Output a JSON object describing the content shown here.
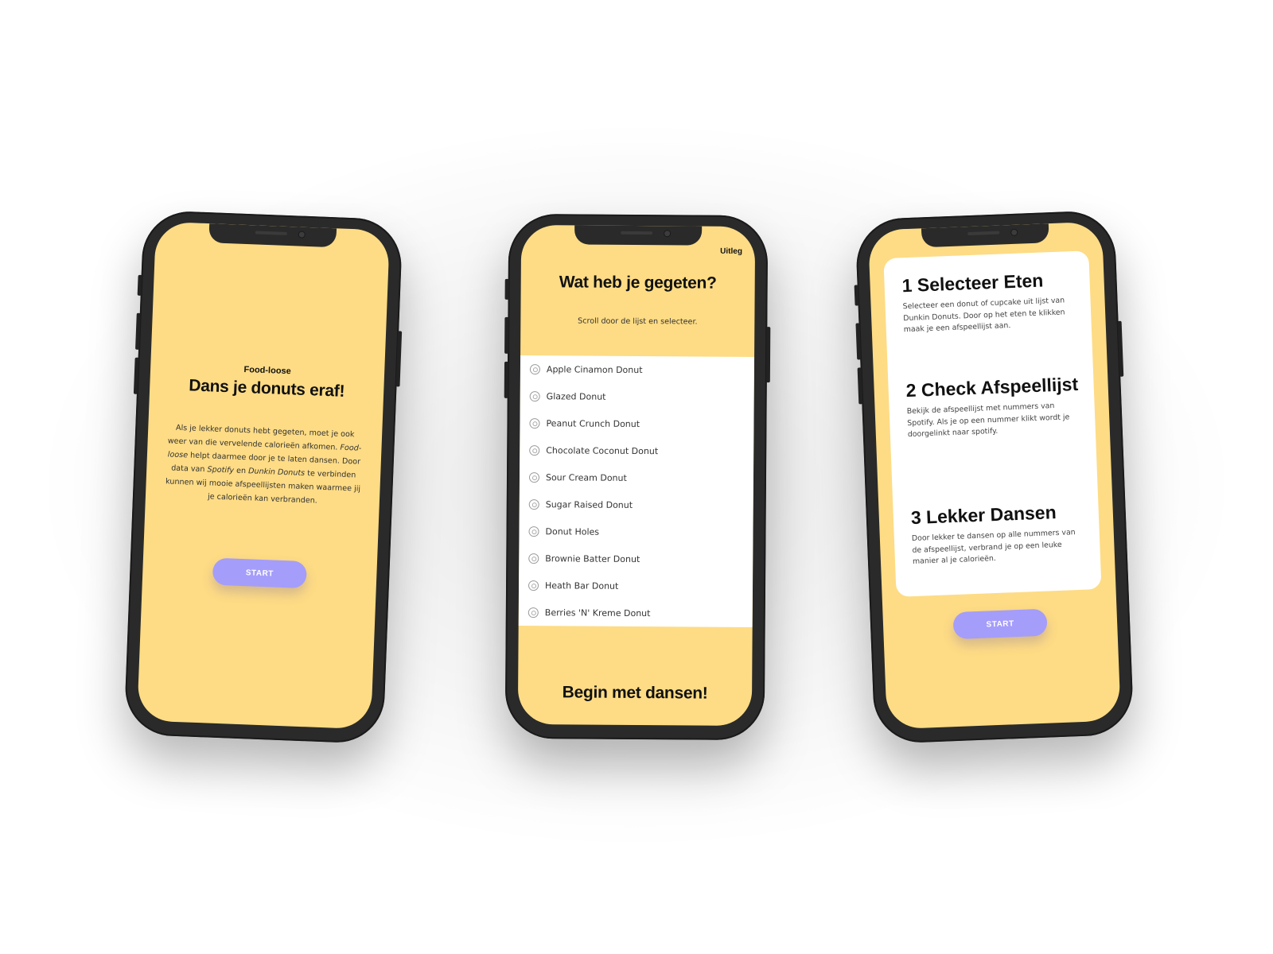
{
  "screen1": {
    "brand": "Food-loose",
    "title": "Dans je donuts eraf!",
    "body": {
      "p1": "Als je lekker donuts hebt gegeten, moet je ook weer van die vervelende calorieën afkomen. ",
      "brand_em": "Food-loose",
      "p2": " helpt daarmee door je te laten dansen. Door data van ",
      "spotify_em": "Spotify",
      "p3": " en ",
      "dunkin_em": "Dunkin Donuts",
      "p4": " te verbinden kunnen wij mooie afspeellijsten maken waarmee jij je calorieën kan verbranden."
    },
    "start_label": "START"
  },
  "screen2": {
    "explain_link": "Uitleg",
    "title": "Wat heb je gegeten?",
    "subtitle": "Scroll door de lijst en selecteer.",
    "items": [
      "Apple Cinamon Donut",
      "Glazed Donut",
      "Peanut Crunch Donut",
      "Chocolate Coconut Donut",
      "Sour Cream Donut",
      "Sugar Raised Donut",
      "Donut Holes",
      "Brownie Batter Donut",
      "Heath Bar Donut",
      "Berries 'N' Kreme Donut"
    ],
    "item_icon": "donut-icon",
    "bottom_title": "Begin met dansen!"
  },
  "screen3": {
    "steps": [
      {
        "title": "1 Selecteer Eten",
        "text": "Selecteer een donut of cupcake uit lijst van Dunkin Donuts. Door op het eten te klikken maak je een afspeellijst aan."
      },
      {
        "title": "2 Check Afspeellijst",
        "text": "Bekijk de afspeellijst met nummers van Spotify. Als je op een nummer klikt wordt je doorgelinkt naar spotify."
      },
      {
        "title": "3 Lekker Dansen",
        "text": "Door lekker te dansen op alle nummers van de afspeellijst, verbrand je op een leuke manier al je calorieën."
      }
    ],
    "start_label": "START"
  },
  "colors": {
    "screen_bg": "#fedc85",
    "button": "#a59dfa",
    "phone_frame": "#2a2a2a"
  }
}
